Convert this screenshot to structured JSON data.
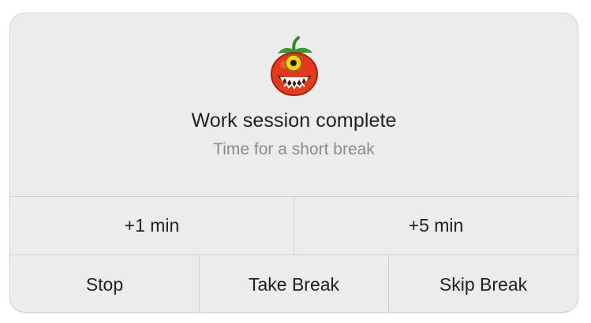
{
  "dialog": {
    "mascot_icon": "tomato-monster-icon",
    "title": "Work session complete",
    "subtitle": "Time for a short break"
  },
  "extend_buttons": [
    {
      "label": "+1 min"
    },
    {
      "label": "+5 min"
    }
  ],
  "action_buttons": [
    {
      "label": "Stop"
    },
    {
      "label": "Take Break"
    },
    {
      "label": "Skip Break"
    }
  ],
  "colors": {
    "tomato": "#e23a1c",
    "leaf": "#2f8a2a",
    "eye": "#f2d31c"
  }
}
